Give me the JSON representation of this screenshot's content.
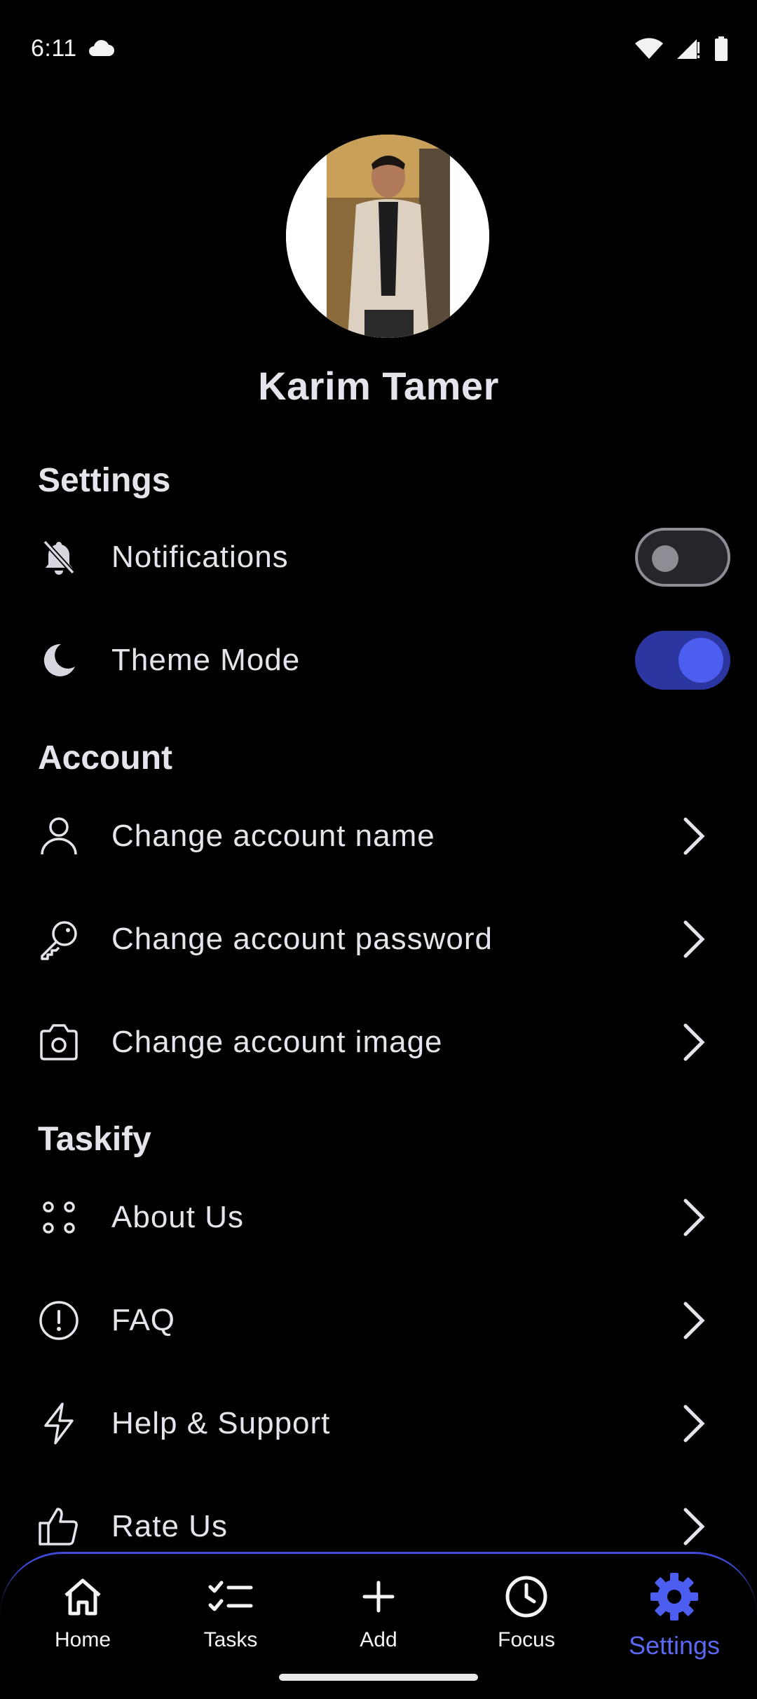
{
  "status_bar": {
    "time": "6:11",
    "icons": [
      "cloud-icon",
      "wifi-icon",
      "signal-icon",
      "battery-icon"
    ]
  },
  "profile": {
    "name": "Karim Tamer",
    "avatar": "profile-photo"
  },
  "sections": {
    "settings": {
      "title": "Settings",
      "notifications": {
        "label": "Notifications",
        "icon": "bell-off-icon",
        "enabled": false
      },
      "theme_mode": {
        "label": "Theme Mode",
        "icon": "moon-icon",
        "enabled": true
      }
    },
    "account": {
      "title": "Account",
      "items": [
        {
          "label": "Change account name",
          "icon": "user-icon"
        },
        {
          "label": "Change account password",
          "icon": "key-icon"
        },
        {
          "label": "Change account image",
          "icon": "camera-icon"
        }
      ]
    },
    "taskify": {
      "title": "Taskify",
      "items": [
        {
          "label": "About Us",
          "icon": "dots-grid-icon"
        },
        {
          "label": "FAQ",
          "icon": "info-circle-icon"
        },
        {
          "label": "Help & Support",
          "icon": "lightning-icon"
        },
        {
          "label": "Rate Us",
          "icon": "thumbs-up-icon"
        }
      ]
    }
  },
  "bottom_nav": {
    "items": [
      {
        "label": "Home",
        "icon": "home-icon"
      },
      {
        "label": "Tasks",
        "icon": "checklist-icon"
      },
      {
        "label": "Add",
        "icon": "plus-icon"
      },
      {
        "label": "Focus",
        "icon": "clock-icon"
      },
      {
        "label": "Settings",
        "icon": "gear-icon",
        "active": true
      }
    ]
  },
  "colors": {
    "background": "#000000",
    "accent": "#4c5ef0",
    "text": "#e6e3ea"
  }
}
